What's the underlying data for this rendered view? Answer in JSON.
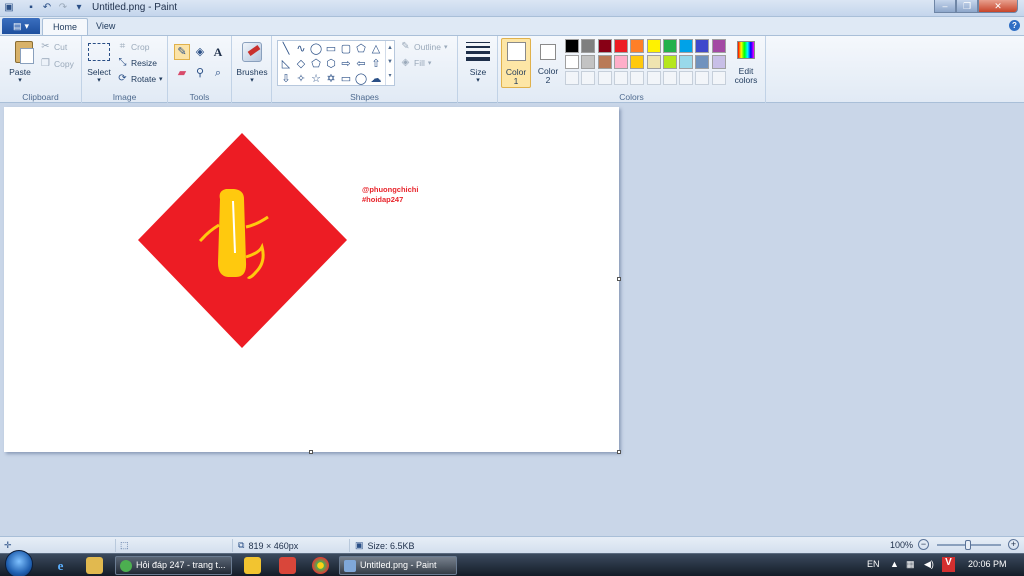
{
  "window": {
    "title": "Untitled.png - Paint"
  },
  "tabs": [
    {
      "label": "Home"
    },
    {
      "label": "View"
    }
  ],
  "ribbon": {
    "clipboard": {
      "label": "Clipboard",
      "paste": "Paste",
      "cut": "Cut",
      "copy": "Copy"
    },
    "image": {
      "label": "Image",
      "select": "Select",
      "crop": "Crop",
      "resize": "Resize",
      "rotate": "Rotate"
    },
    "tools": {
      "label": "Tools"
    },
    "brushes": {
      "label": "Brushes"
    },
    "shapes": {
      "label": "Shapes",
      "outline": "Outline",
      "fill": "Fill"
    },
    "size": {
      "label": "Size"
    },
    "colors": {
      "label": "Colors",
      "color1": "Color",
      "color1_num": "1",
      "color2": "Color",
      "color2_num": "2",
      "edit": "Edit",
      "edit2": "colors",
      "color1_value": "#ffffff",
      "color2_value": "#ffffff",
      "palette_row1": [
        "#000000",
        "#7f7f7f",
        "#880015",
        "#ed1c24",
        "#ff7f27",
        "#fff200",
        "#22b14c",
        "#00a2e8",
        "#3f48cc",
        "#a349a4"
      ],
      "palette_row2": [
        "#ffffff",
        "#c3c3c3",
        "#b97a57",
        "#ffaec9",
        "#ffc90e",
        "#efe4b0",
        "#b5e61d",
        "#99d9ea",
        "#7092be",
        "#c8bfe7"
      ]
    }
  },
  "canvas": {
    "watermark_line1": "@phuongchichi",
    "watermark_line2": "#hoidap247",
    "diamond_color": "#ed1c24",
    "figure_color": "#ffc90e"
  },
  "status": {
    "dimensions": "819 × 460px",
    "size": "Size: 6.5KB",
    "zoom": "100%"
  },
  "taskbar": {
    "task1": "Hỏi đáp 247 - trang t...",
    "task2": "Untitled.png - Paint",
    "lang": "EN",
    "time": "20:06 PM"
  }
}
